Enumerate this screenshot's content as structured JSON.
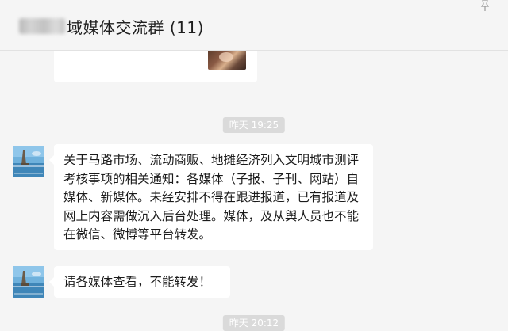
{
  "header": {
    "title_suffix": "域媒体交流群 (11)"
  },
  "messages": {
    "ts1": "昨天 19:25",
    "msg1": "关于马路市场、流动商贩、地摊经济列入文明城市测评考核事项的相关通知：各媒体（子报、子刊、网站）自媒体、新媒体。未经安排不得在跟进报道，已有报道及网上内容需做沉入后台处理。媒体，及从舆人员也不能在微信、微博等平台转发。",
    "msg2": "请各媒体查看，不能转发！",
    "ts2": "昨天 20:12"
  },
  "colors": {
    "background": "#f5f5f5",
    "bubble": "#ffffff",
    "timestamp_bg": "#dadada",
    "timestamp_text": "#ffffff"
  },
  "icons": {
    "pin": "pin-icon",
    "avatar": "lakeside-avatar"
  }
}
